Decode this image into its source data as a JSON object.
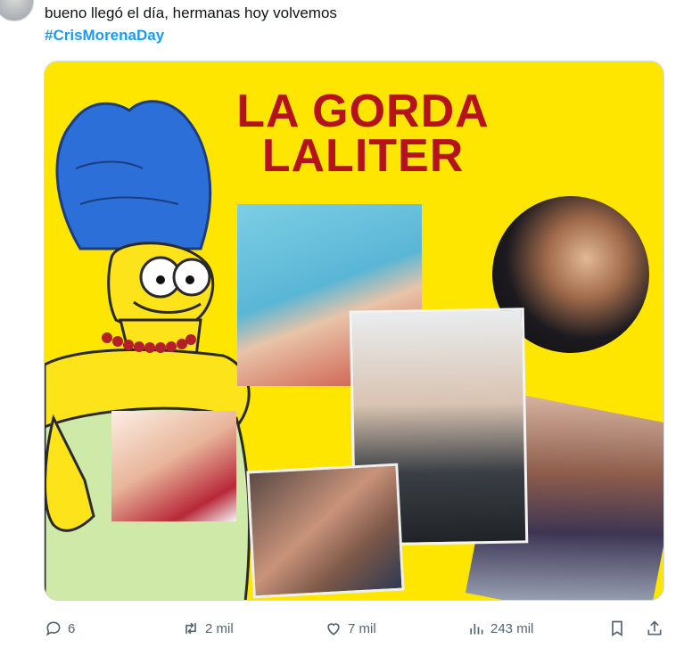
{
  "tweet": {
    "text": "bueno llegó el día, hermanas hoy volvemos",
    "hashtag": "#CrisMorenaDay"
  },
  "media": {
    "title_line1": "LA GORDA",
    "title_line2": "LALITER",
    "background_color": "#ffe600",
    "title_color": "#b5121b"
  },
  "actions": {
    "reply_count": "6",
    "retweet_count": "2 mil",
    "like_count": "7 mil",
    "view_count": "243 mil"
  },
  "colors": {
    "accent": "#1d9bf0",
    "muted": "#536471"
  }
}
